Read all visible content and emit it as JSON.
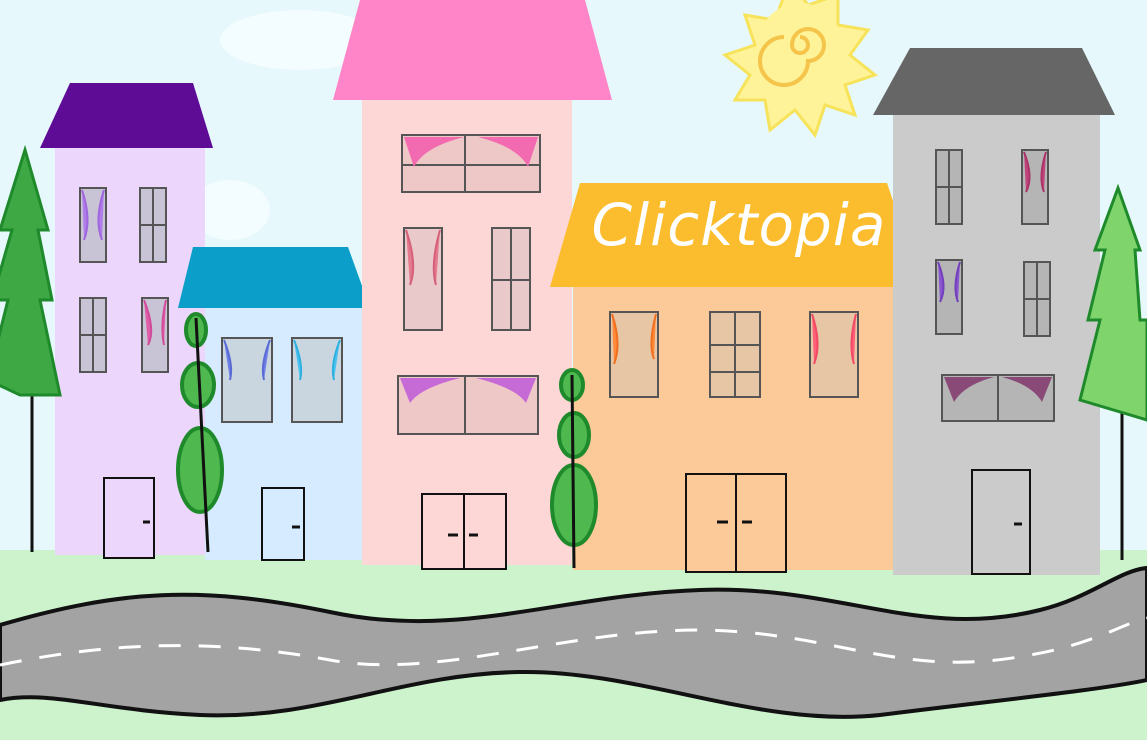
{
  "scene": {
    "sign_text": "Clicktopia"
  },
  "colors": {
    "sky": "#e6f8fb",
    "grass": "#cdf3cd",
    "road": "#a3a3a3",
    "road_edge": "#111111",
    "road_dash": "#ffffff",
    "sun": "#fff39a",
    "sun_spiral": "#f4c54a",
    "house1_wall": "#ecd6fb",
    "house1_roof": "#5e0b96",
    "house2_wall": "#d6ebff",
    "house2_roof": "#0a9ec9",
    "house3_wall": "#fdd6d6",
    "house3_roof": "#ff84c8",
    "house4_wall": "#fcc998",
    "house4_roof": "#fbbd2e",
    "house5_wall": "#cbcbcb",
    "house5_roof": "#666666",
    "tree_dark": "#1f8a2b",
    "tree_light": "#5fcb55"
  },
  "icons": [
    "sun-icon",
    "pine-tree-icon",
    "round-tree-icon",
    "door-icon",
    "window-icon",
    "curtain-icon"
  ]
}
